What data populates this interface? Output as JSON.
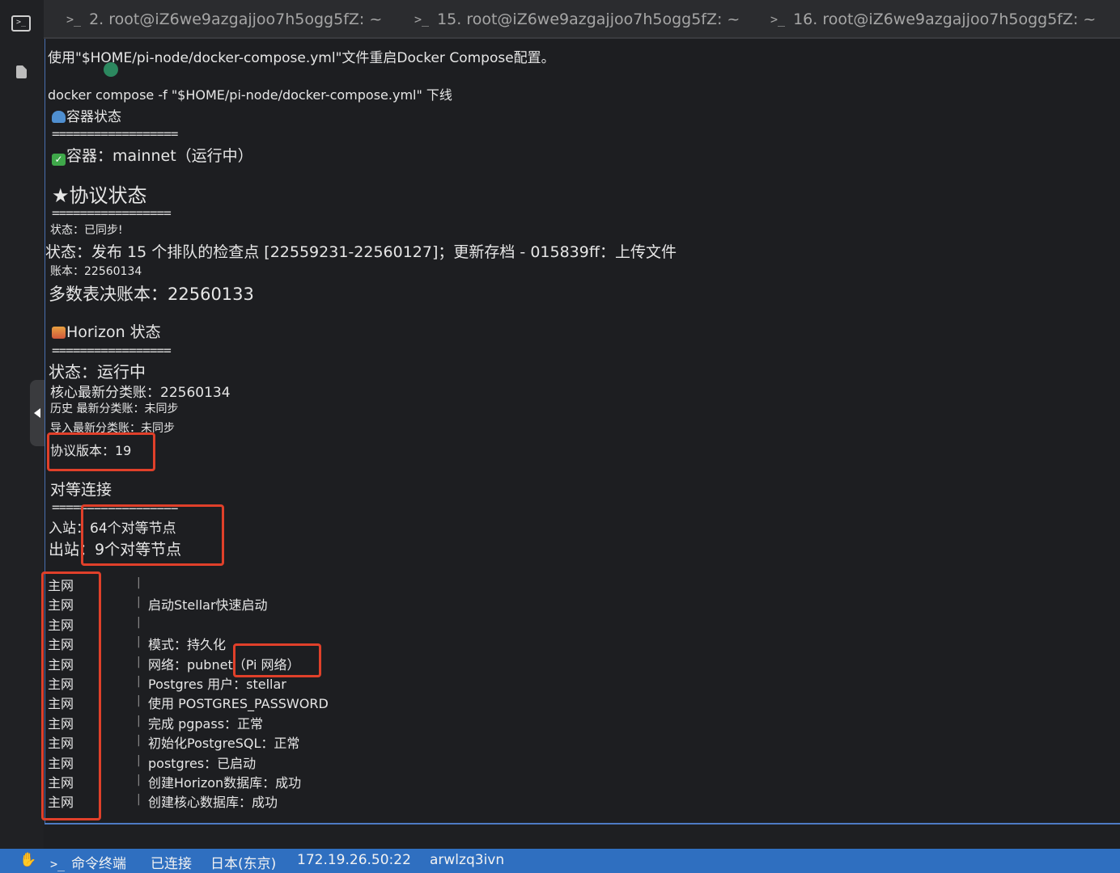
{
  "tabs": [
    {
      "label": "2. root@iZ6we9azgajjoo7h5ogg5fZ: ~"
    },
    {
      "label": "15. root@iZ6we9azgajjoo7h5ogg5fZ: ~"
    },
    {
      "label": "16. root@iZ6we9azgajjoo7h5ogg5fZ: ~"
    }
  ],
  "terminal": {
    "line1": "使用\"$HOME/pi-node/docker-compose.yml\"文件重启Docker Compose配置。",
    "line2": "docker compose -f \"$HOME/pi-node/docker-compose.yml\" 下线",
    "container_title": "容器状态",
    "separator_long": "==================",
    "separator_short": "=================",
    "container_line": "容器：mainnet（运行中）",
    "protocol_title": "★协议状态",
    "status_synced": "状态：已同步!",
    "status_publish": "状态：发布 15 个排队的检查点 [22559231-22560127]；更新存档 - 015839ff：上传文件",
    "ledger": "账本：22560134",
    "quorum_ledger": "多数表决账本：22560133",
    "horizon_title": "Horizon 状态",
    "horizon_status": "状态：运行中",
    "core_latest": "核心最新分类账：22560134",
    "history_latest": "历史 最新分类账：未同步",
    "ingest_latest": "导入最新分类账：未同步",
    "protocol_version": "协议版本：19",
    "peers_title": "对等连接",
    "inbound": "入站：64个对等节点",
    "outbound": "出站：9个对等节点",
    "log_prefix": "主网",
    "log_bar": "|",
    "log_messages": [
      "",
      "启动Stellar快速启动",
      "",
      "模式：持久化",
      "网络：pubnet（Pi 网络）",
      "Postgres 用户：stellar",
      "使用 POSTGRES_PASSWORD",
      "完成 pgpass：正常",
      "初始化PostgreSQL：正常",
      "postgres：已启动",
      "创建Horizon数据库：成功",
      "创建核心数据库：成功"
    ]
  },
  "statusbar": {
    "hand_icon": "✋",
    "terminal_label": "命令终端",
    "connected": "已连接",
    "region": "日本(东京)",
    "ip": "172.19.26.50:22",
    "host": "arwlzq3ivn"
  },
  "icons": {
    "prompt": ">_",
    "terminal_box": ">_"
  },
  "colors": {
    "highlight": "#e0402a",
    "statusbar": "#2f6fc0"
  }
}
